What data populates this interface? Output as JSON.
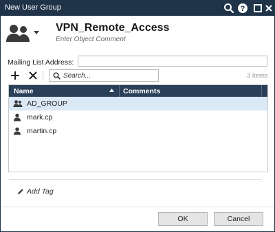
{
  "window": {
    "title": "New User Group",
    "controls": [
      "search-icon",
      "help-icon",
      "maximize-icon",
      "close-icon"
    ],
    "title_bar_color": "#1f3349"
  },
  "object": {
    "icon": "user-group-icon",
    "name": "VPN_Remote_Access",
    "comment_placeholder": "Enter Object Comment"
  },
  "mailing_list": {
    "label": "Mailing List Address:",
    "value": ""
  },
  "toolbar": {
    "add_icon": "plus-icon",
    "remove_icon": "x-icon",
    "search_placeholder": "Search...",
    "items_count": "3 items"
  },
  "table": {
    "header_color": "#2a3f58",
    "columns": [
      "Name",
      "Comments"
    ],
    "sort_column": "Name",
    "rows": [
      {
        "icon": "user-group-icon",
        "name": "AD_GROUP",
        "comment": "",
        "selected": true
      },
      {
        "icon": "user-icon",
        "name": "mark.cp",
        "comment": "",
        "selected": false
      },
      {
        "icon": "user-icon",
        "name": "martin.cp",
        "comment": "",
        "selected": false
      }
    ]
  },
  "tags": {
    "icon": "pencil-icon",
    "add_label": "Add Tag"
  },
  "buttons": {
    "ok": "OK",
    "cancel": "Cancel"
  }
}
